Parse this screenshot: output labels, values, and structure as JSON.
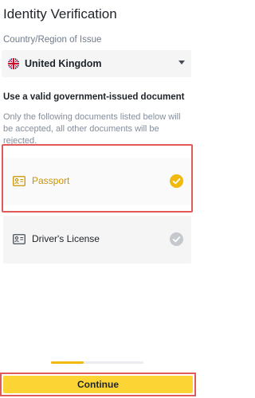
{
  "header": {
    "title": "Identity Verification"
  },
  "country": {
    "label": "Country/Region of Issue",
    "value": "United Kingdom",
    "flag_icon": "uk-flag-icon"
  },
  "documents": {
    "heading": "Use a valid government-issued document",
    "note": "Only the following documents listed below will be accepted, all other documents will be rejected.",
    "options": [
      {
        "label": "Passport",
        "icon": "passport-card-icon",
        "selected": true
      },
      {
        "label": "Driver's License",
        "icon": "id-card-icon",
        "selected": false
      }
    ]
  },
  "progress": {
    "fraction": 0.35
  },
  "footer": {
    "continue_label": "Continue"
  },
  "colors": {
    "accent": "#fcd535",
    "selected_text": "#c99400",
    "check_selected": "#f0b90b",
    "check_unselected": "#c5c8cc",
    "highlight": "#e05a5a"
  }
}
